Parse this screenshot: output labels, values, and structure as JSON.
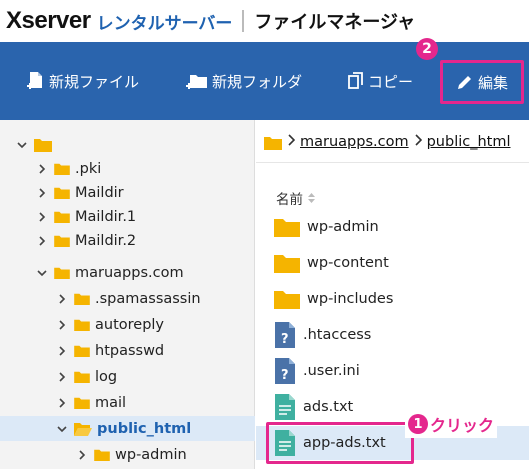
{
  "header": {
    "brand": "Xserver",
    "brand_sub": "レンタルサーバー",
    "title": "ファイルマネージャ"
  },
  "toolbar": {
    "new_file": "新規ファイル",
    "new_folder": "新規フォルダ",
    "copy": "コピー",
    "edit": "編集",
    "edit_badge": "2"
  },
  "tree": {
    "items": [
      {
        "label": "",
        "depth": 0,
        "expanded": true
      },
      {
        "label": ".pki",
        "depth": 1,
        "expanded": false
      },
      {
        "label": "Maildir",
        "depth": 1,
        "expanded": false
      },
      {
        "label": "Maildir.1",
        "depth": 1,
        "expanded": false
      },
      {
        "label": "Maildir.2",
        "depth": 1,
        "expanded": false
      },
      {
        "label": "maruapps.com",
        "depth": 1,
        "expanded": true
      },
      {
        "label": ".spamassassin",
        "depth": 2,
        "expanded": false
      },
      {
        "label": "autoreply",
        "depth": 2,
        "expanded": false
      },
      {
        "label": "htpasswd",
        "depth": 2,
        "expanded": false
      },
      {
        "label": "log",
        "depth": 2,
        "expanded": false
      },
      {
        "label": "mail",
        "depth": 2,
        "expanded": false
      },
      {
        "label": "public_html",
        "depth": 2,
        "expanded": true,
        "selected": true
      },
      {
        "label": "wp-admin",
        "depth": 3,
        "expanded": false
      }
    ]
  },
  "breadcrumb": {
    "segments": [
      "maruapps.com",
      "public_html"
    ]
  },
  "file_list": {
    "column_name": "名前",
    "items": [
      {
        "name": "wp-admin",
        "icon": "folder-icon"
      },
      {
        "name": "wp-content",
        "icon": "folder-icon"
      },
      {
        "name": "wp-includes",
        "icon": "folder-icon"
      },
      {
        "name": ".htaccess",
        "icon": "unknown-file-icon"
      },
      {
        "name": ".user.ini",
        "icon": "unknown-file-icon"
      },
      {
        "name": "ads.txt",
        "icon": "text-file-icon"
      },
      {
        "name": "app-ads.txt",
        "icon": "text-file-icon"
      }
    ]
  },
  "annotation": {
    "click_badge": "1",
    "click_text": "クリック"
  },
  "colors": {
    "toolbar_bg": "#2a64ad",
    "accent_pink": "#e4278d",
    "folder": "#f5b400",
    "selected_bg": "#dce9f7"
  }
}
